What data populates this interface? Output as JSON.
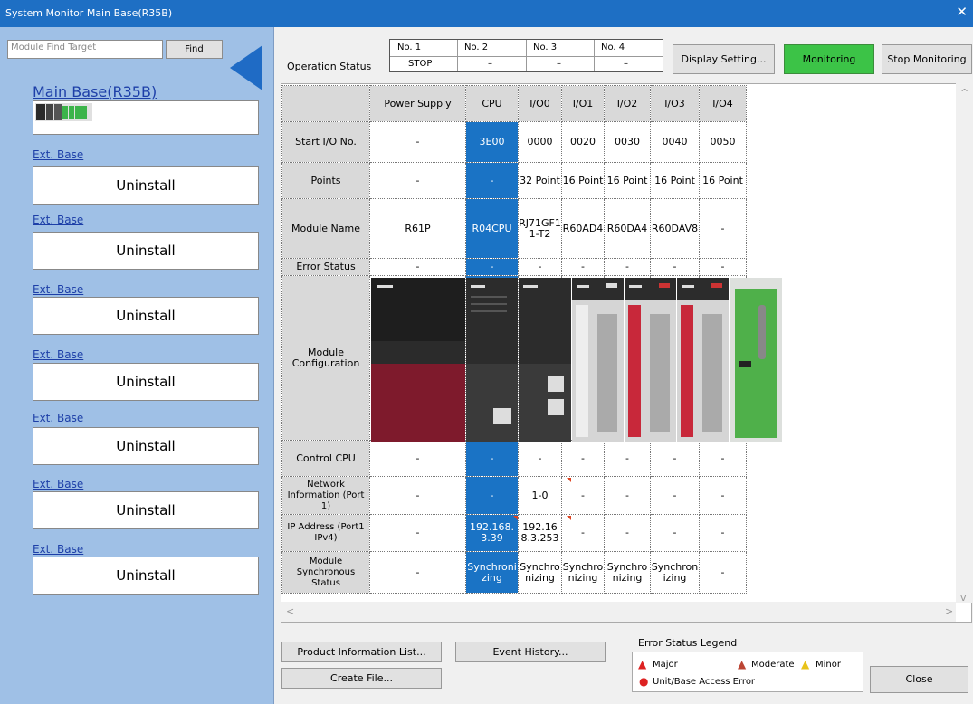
{
  "window": {
    "title": "System Monitor Main Base(R35B)",
    "close_glyph": "✕"
  },
  "left": {
    "find_placeholder": "Module Find Target",
    "find_label": "Find",
    "main_base_title": "Main Base(R35B)",
    "ext_bases": [
      {
        "label": "Ext. Base",
        "state": "Uninstall"
      },
      {
        "label": "Ext. Base",
        "state": "Uninstall"
      },
      {
        "label": "Ext. Base",
        "state": "Uninstall"
      },
      {
        "label": "Ext. Base",
        "state": "Uninstall"
      },
      {
        "label": "Ext. Base",
        "state": "Uninstall"
      },
      {
        "label": "Ext. Base",
        "state": "Uninstall"
      },
      {
        "label": "Ext. Base",
        "state": "Uninstall"
      }
    ]
  },
  "operation": {
    "label": "Operation Status",
    "cols": [
      {
        "no": "No. 1",
        "val": "STOP"
      },
      {
        "no": "No. 2",
        "val": "–"
      },
      {
        "no": "No. 3",
        "val": "–"
      },
      {
        "no": "No. 4",
        "val": "–"
      }
    ]
  },
  "toolbar": {
    "display_setting": "Display Setting...",
    "monitoring": "Monitoring",
    "stop_monitoring": "Stop Monitoring"
  },
  "grid": {
    "headers": [
      "",
      "Power Supply",
      "CPU",
      "I/O0",
      "I/O1",
      "I/O2",
      "I/O3",
      "I/O4"
    ],
    "rows": [
      {
        "label": "Start I/O No.",
        "cells": [
          "-",
          "3E00",
          "0000",
          "0020",
          "0030",
          "0040",
          "0050"
        ]
      },
      {
        "label": "Points",
        "cells": [
          "-",
          "-",
          "32 Point",
          "16 Point",
          "16 Point",
          "16 Point",
          "16 Point"
        ]
      },
      {
        "label": "Module Name",
        "cells": [
          "R61P",
          "R04CPU",
          "RJ71GF11-T2",
          "R60AD4",
          "R60DA4",
          "R60DAV8",
          "-"
        ]
      },
      {
        "label": "Error Status",
        "cells": [
          "-",
          "-",
          "-",
          "-",
          "-",
          "-",
          "-"
        ]
      },
      {
        "label": "Module Configuration",
        "cells": [
          "",
          "",
          "",
          "",
          "",
          "",
          ""
        ]
      },
      {
        "label": "Control CPU",
        "cells": [
          "-",
          "-",
          "-",
          "-",
          "-",
          "-",
          "-"
        ]
      },
      {
        "label": "Network Information (Port 1)",
        "cells": [
          "-",
          "-",
          "1-0",
          "-",
          "-",
          "-",
          "-"
        ]
      },
      {
        "label": "IP Address (Port1 IPv4)",
        "cells": [
          "-",
          "192.168.3.39",
          "192.168.3.253",
          "-",
          "-",
          "-",
          "-"
        ]
      },
      {
        "label": "Module Synchronous Status",
        "cells": [
          "-",
          "Synchronizing",
          "Synchronizing",
          "Synchronizing",
          "Synchronizing",
          "Synchronizing",
          "-"
        ]
      }
    ],
    "accent_color": "#1a73c5"
  },
  "bottom": {
    "product_info": "Product Information List...",
    "event_history": "Event History...",
    "create_file": "Create File...",
    "close": "Close",
    "legend_title": "Error Status Legend",
    "legend_major": "Major",
    "legend_moderate": "Moderate",
    "legend_minor": "Minor",
    "legend_access": "Unit/Base Access Error"
  }
}
